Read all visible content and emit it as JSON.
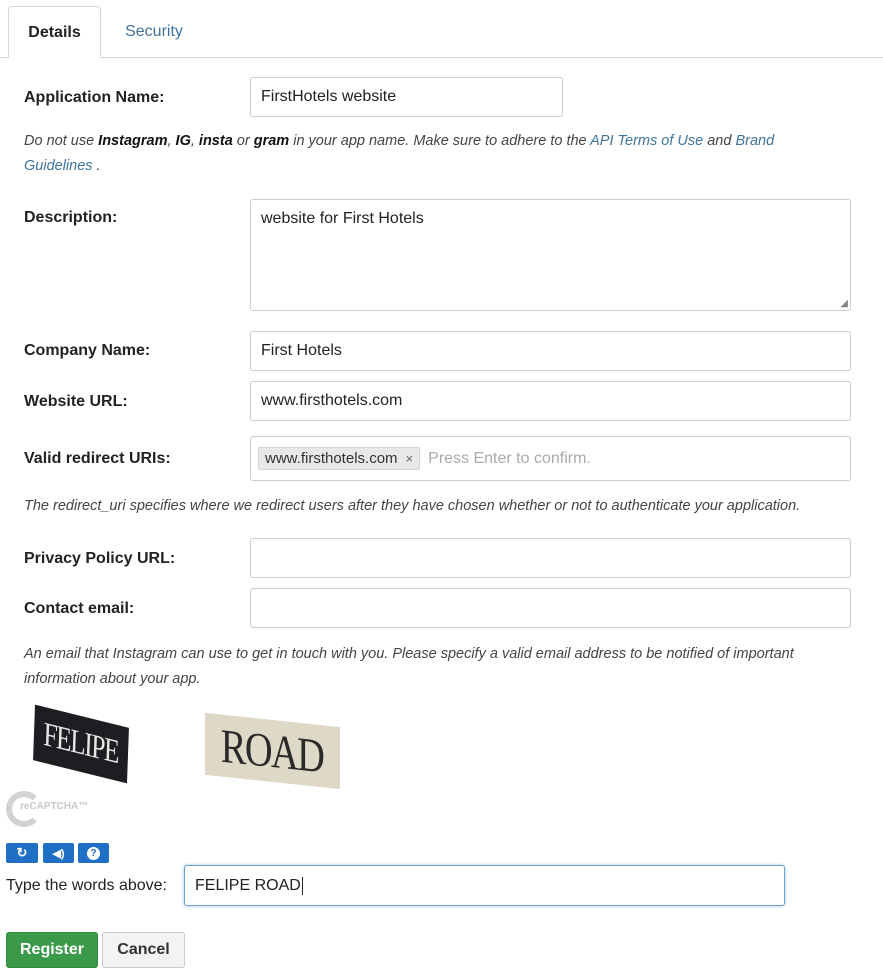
{
  "tabs": {
    "details": "Details",
    "security": "Security"
  },
  "form": {
    "app_name_label": "Application Name:",
    "app_name_value": "FirstHotels website",
    "app_name_help": {
      "p1": "Do not use ",
      "b1": "Instagram",
      "p2": ", ",
      "b2": "IG",
      "p3": ", ",
      "b3": "insta",
      "p4": " or ",
      "b4": "gram",
      "p5": " in your app name. Make sure to adhere to the ",
      "link1": "API Terms of Use",
      "p6": " and ",
      "link2": "Brand Guidelines",
      "p7": " ."
    },
    "description_label": "Description:",
    "description_value": "website for First Hotels",
    "company_label": "Company Name:",
    "company_value": "First Hotels",
    "website_label": "Website URL:",
    "website_value": "www.firsthotels.com",
    "redirect_label": "Valid redirect URIs:",
    "redirect_chip": "www.firsthotels.com",
    "redirect_chip_remove": "×",
    "redirect_placeholder": "Press Enter to confirm.",
    "redirect_help": "The redirect_uri specifies where we redirect users after they have chosen whether or not to authenticate your application.",
    "privacy_label": "Privacy Policy URL:",
    "privacy_value": "",
    "contact_label": "Contact email:",
    "contact_value": "",
    "contact_help": "An email that Instagram can use to get in touch with you. Please specify a valid email address to be notified of important information about your app."
  },
  "captcha": {
    "word1": "FELIPE",
    "word2": "ROAD",
    "logo_text": "reCAPTCHA™",
    "refresh_icon": "refresh-icon",
    "audio_icon": "audio-icon",
    "help_icon": "help-icon",
    "prompt": "Type the words above:",
    "input_value": "FELIPE ROAD"
  },
  "buttons": {
    "register": "Register",
    "cancel": "Cancel"
  },
  "colors": {
    "link": "#3f729b",
    "register": "#3a9a4a",
    "captcha_btn": "#1f6fc5"
  }
}
